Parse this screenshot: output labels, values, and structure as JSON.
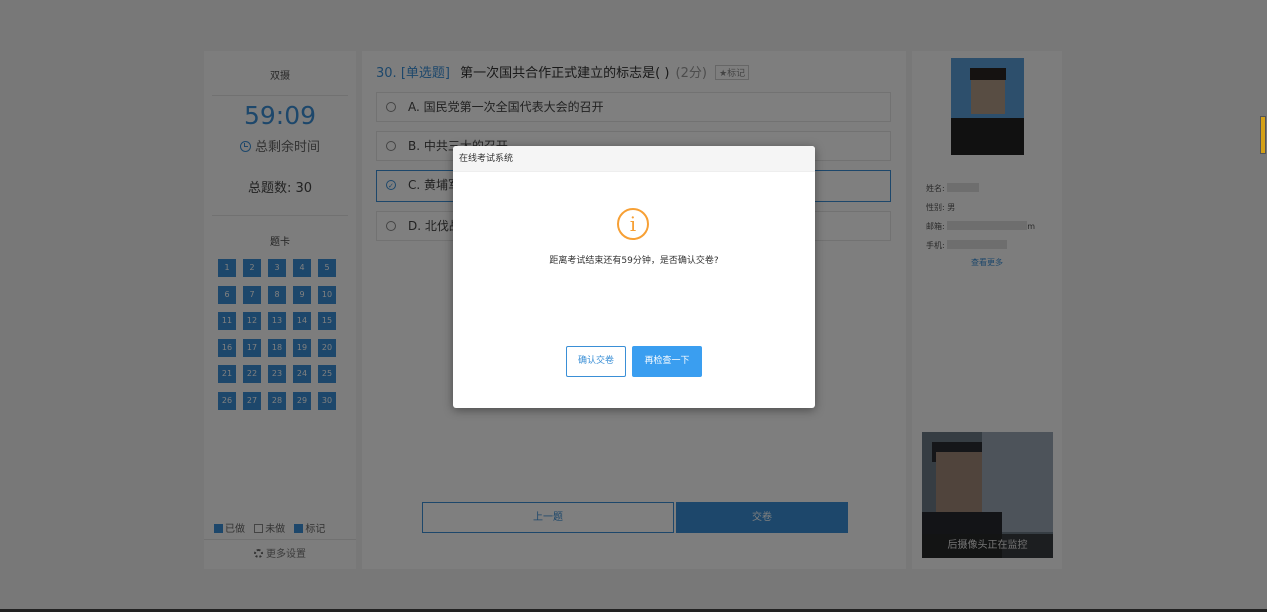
{
  "left_panel": {
    "mode_label": "双摄",
    "timer": "59:09",
    "remaining_label": "总剩余时间",
    "total_label": "总题数: 30",
    "card_title": "题卡",
    "questions": [
      "1",
      "2",
      "3",
      "4",
      "5",
      "6",
      "7",
      "8",
      "9",
      "10",
      "11",
      "12",
      "13",
      "14",
      "15",
      "16",
      "17",
      "18",
      "19",
      "20",
      "21",
      "22",
      "23",
      "24",
      "25",
      "26",
      "27",
      "28",
      "29",
      "30"
    ],
    "legend": {
      "done": "已做",
      "undone": "未做",
      "flagged": "标记"
    },
    "settings_label": "更多设置"
  },
  "question": {
    "number": "30.",
    "type": "[单选题]",
    "stem": "第一次国共合作正式建立的标志是( )",
    "score": "(2分)",
    "mark_label": "★标记",
    "options": [
      {
        "label": "A. 国民党第一次全国代表大会的召开",
        "selected": false
      },
      {
        "label": "B. 中共三大的召开",
        "selected": false
      },
      {
        "label": "C. 黄埔军",
        "selected": true
      },
      {
        "label": "D. 北伐战",
        "selected": false
      }
    ],
    "prev_button": "上一题",
    "submit_button": "交卷"
  },
  "profile": {
    "name_label": "姓名:",
    "gender_label": "性别:",
    "gender_value": "男",
    "email_label": "邮箱:",
    "email_suffix": "m",
    "phone_label": "手机:",
    "more_link": "查看更多",
    "camera_label": "后摄像头正在监控"
  },
  "dialog": {
    "title": "在线考试系统",
    "icon": "info-icon",
    "message": "距离考试结束还有59分钟，是否确认交卷?",
    "confirm_button": "确认交卷",
    "recheck_button": "再检查一下"
  },
  "colors": {
    "accent": "#3a8fd6",
    "warning": "#f7a035",
    "overlay": "rgba(0,0,0,0.5)"
  }
}
